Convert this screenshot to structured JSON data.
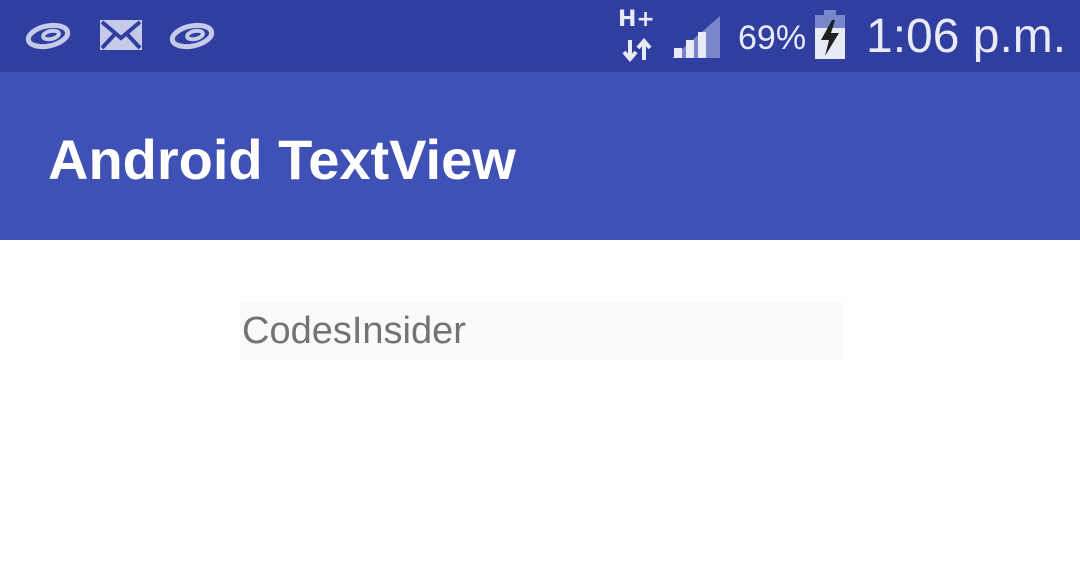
{
  "status_bar": {
    "notification_icons": [
      "swirl-notification-icon",
      "mail-icon",
      "swirl-notification-icon"
    ],
    "network_type": "H+",
    "battery_percent": "69%",
    "time": "1:06 p.m.",
    "signal_level": 0.75,
    "battery_level": 0.69
  },
  "toolbar": {
    "title": "Android TextView"
  },
  "content": {
    "textview_text": "CodesInsider"
  },
  "colors": {
    "status_bar": "#303f9f",
    "toolbar": "#3f51b5",
    "textview_background": "#fafafa",
    "textview_text": "#737373"
  }
}
